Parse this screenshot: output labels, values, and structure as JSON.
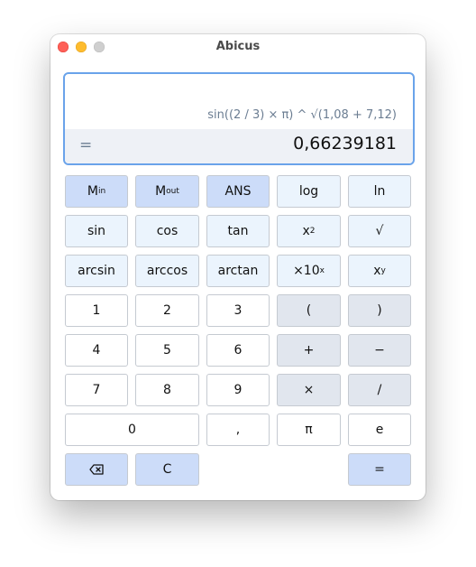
{
  "window": {
    "title": "Abicus"
  },
  "display": {
    "expression": "sin((2 / 3) × π) ^ √(1,08 + 7,12)",
    "equals": "=",
    "result": "0,66239181"
  },
  "keys": {
    "m_in": {
      "base": "M",
      "sub": "in"
    },
    "m_out": {
      "base": "M",
      "sub": "out"
    },
    "ans": "ANS",
    "log": "log",
    "ln": "ln",
    "sin": "sin",
    "cos": "cos",
    "tan": "tan",
    "square": {
      "base": "x",
      "sup": "2"
    },
    "sqrt": "√",
    "arcsin": "arcsin",
    "arccos": "arccos",
    "arctan": "arctan",
    "sci": {
      "base": "×10",
      "sup": "x"
    },
    "power": {
      "base": "x",
      "sup": "y"
    },
    "d1": "1",
    "d2": "2",
    "d3": "3",
    "open_paren": "(",
    "close_paren": ")",
    "d4": "4",
    "d5": "5",
    "d6": "6",
    "plus": "+",
    "minus": "−",
    "d7": "7",
    "d8": "8",
    "d9": "9",
    "multiply": "×",
    "divide": "/",
    "d0": "0",
    "comma": ",",
    "pi": "π",
    "e": "e",
    "backspace_icon": "backspace-icon",
    "clear": "C",
    "equals": "="
  },
  "colors": {
    "accent_border": "#6aa3ea",
    "memory_key": "#ccdcf9",
    "function_key": "#ebf4fd",
    "number_key": "#ffffff",
    "operator_key": "#e1e6ee"
  }
}
